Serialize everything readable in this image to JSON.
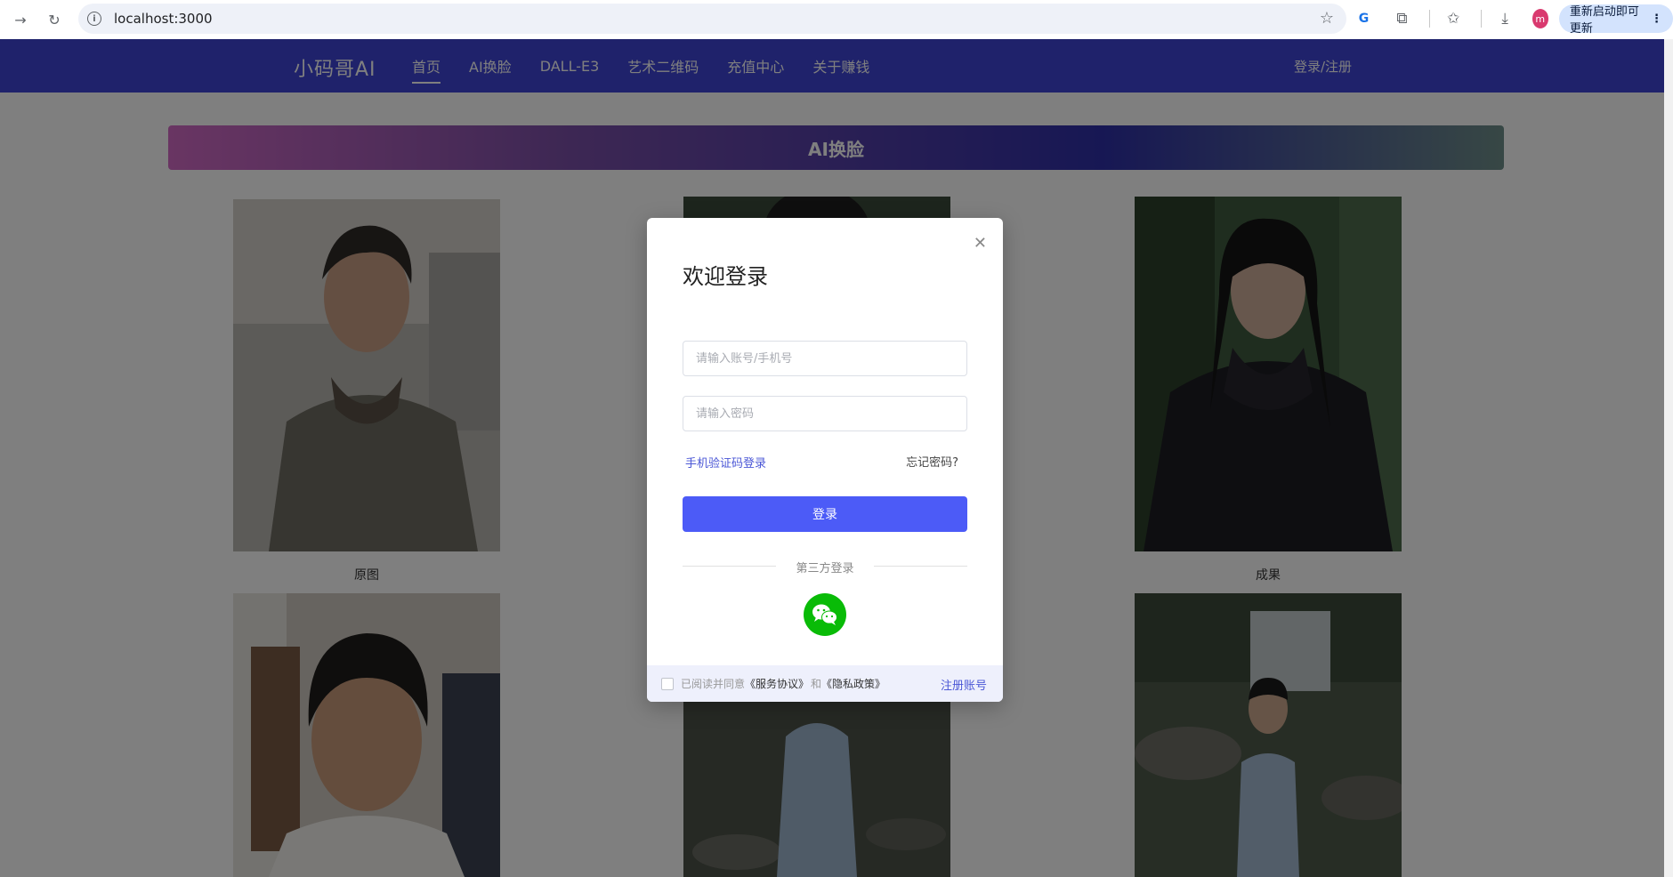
{
  "browser": {
    "url": "localhost:3000",
    "update_label": "重新启动即可更新",
    "avatar_letter": "m"
  },
  "header": {
    "logo": "小码哥AI",
    "nav": [
      {
        "label": "首页",
        "active": true
      },
      {
        "label": "AI换脸",
        "active": false
      },
      {
        "label": "DALL-E3",
        "active": false
      },
      {
        "label": "艺术二维码",
        "active": false
      },
      {
        "label": "充值中心",
        "active": false
      },
      {
        "label": "关于赚钱",
        "active": false
      }
    ],
    "login_label": "登录/注册",
    "bg_color": "#3e44d6"
  },
  "banner": {
    "title": "AI换脸"
  },
  "gallery": {
    "captions": {
      "original": "原图",
      "result": "成果"
    }
  },
  "modal": {
    "title": "欢迎登录",
    "account_placeholder": "请输入账号/手机号",
    "password_placeholder": "请输入密码",
    "sms_login_label": "手机验证码登录",
    "forgot_label": "忘记密码?",
    "submit_label": "登录",
    "third_party_label": "第三方登录",
    "agree_prefix": "已阅读并同意",
    "service_agreement": "《服务协议》",
    "and_text": "和",
    "privacy_policy": "《隐私政策》",
    "register_label": "注册账号",
    "accent_color": "#4c5bf7"
  }
}
